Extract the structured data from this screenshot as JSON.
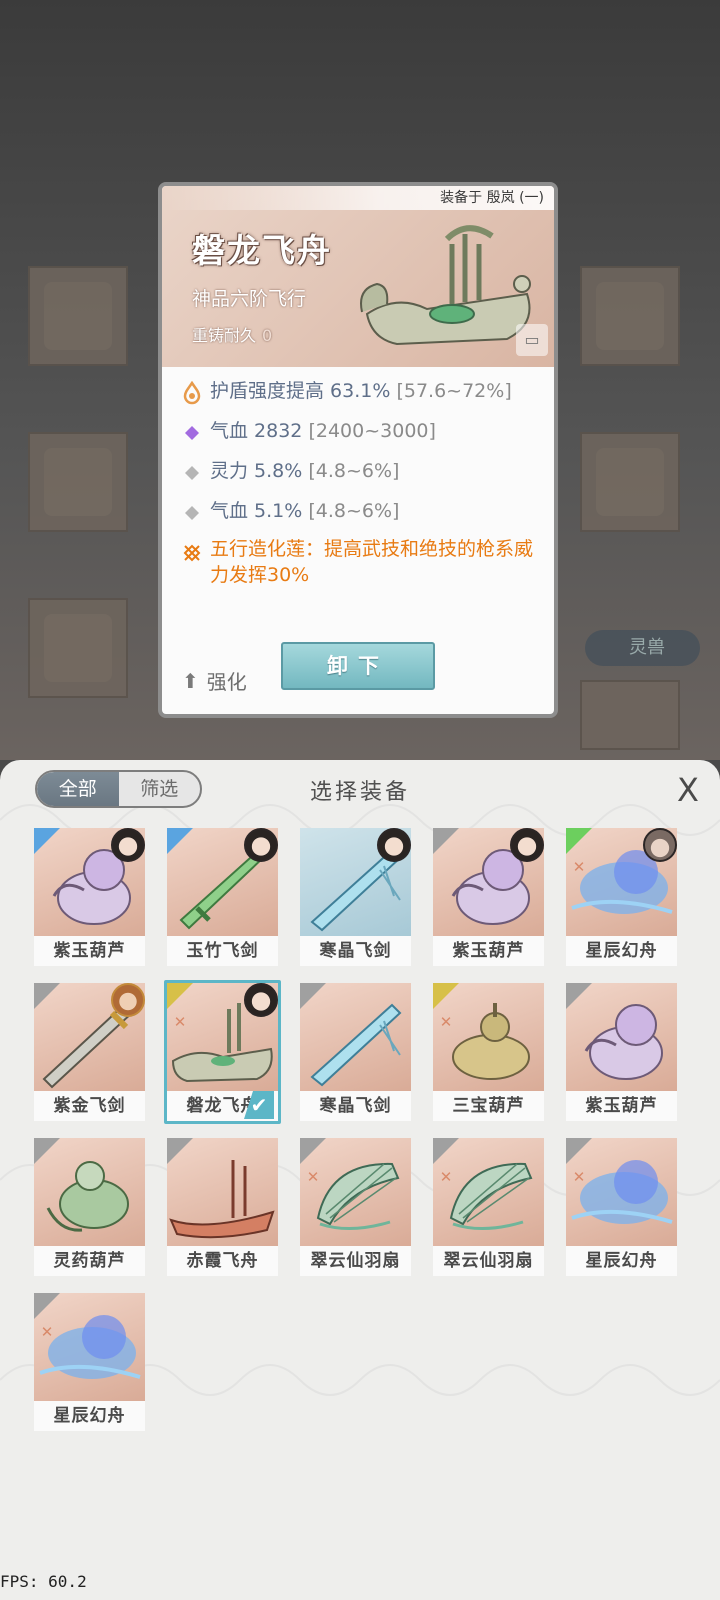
{
  "detail": {
    "equipped_by": "装备于 殷岚 (一)",
    "name": "磐龙飞舟",
    "grade": "神品六阶飞行",
    "reforge_label": "重铸耐久",
    "reforge_value": "0",
    "attributes": [
      {
        "icon": "flame-icon",
        "text": "护盾强度提高 63.1%",
        "range": "[57.6~72%]",
        "color": "#e79a4a"
      },
      {
        "icon": "purple-diamond-icon",
        "text": "气血 2832",
        "range": "[2400~3000]",
        "color": "#a26be0"
      },
      {
        "icon": "gray-diamond-icon",
        "text": "灵力 5.8%",
        "range": "[4.8~6%]",
        "color": "#b5b5b5"
      },
      {
        "icon": "gray-diamond-icon",
        "text": "气血 5.1%",
        "range": "[4.8~6%]",
        "color": "#b5b5b5"
      }
    ],
    "special": "五行造化莲：提高武技和绝技的枪系威力发挥30%",
    "strengthen_label": "强化",
    "unequip_label": "卸下"
  },
  "background": {
    "tag_label": "灵兽"
  },
  "panel": {
    "tabs": [
      "全部",
      "筛选"
    ],
    "title": "选择装备",
    "close_icon": "X"
  },
  "items": [
    {
      "name": "紫玉葫芦",
      "wing": "blue",
      "avatar": "girl",
      "bg": "peach",
      "art": "gourd-purple"
    },
    {
      "name": "玉竹飞剑",
      "wing": "blue",
      "avatar": "girl",
      "bg": "peach",
      "art": "sword-green"
    },
    {
      "name": "寒晶飞剑",
      "wing": "none",
      "avatar": "girl",
      "bg": "blue",
      "art": "sword-blue"
    },
    {
      "name": "紫玉葫芦",
      "wing": "gray",
      "avatar": "girl",
      "bg": "peach",
      "art": "gourd-purple"
    },
    {
      "name": "星辰幻舟",
      "wing": "green",
      "avatar": "cat",
      "bg": "peach",
      "art": "boat-blue",
      "rune": true
    },
    {
      "name": "紫金飞剑",
      "wing": "gray",
      "avatar": "warrior",
      "bg": "peach",
      "art": "sword-gold"
    },
    {
      "name": "磐龙飞舟",
      "wing": "gold",
      "avatar": "girl",
      "bg": "peach",
      "art": "boat-jade",
      "rune": true,
      "selected": true
    },
    {
      "name": "寒晶飞剑",
      "wing": "gray",
      "avatar": "none",
      "bg": "peach",
      "art": "sword-blue"
    },
    {
      "name": "三宝葫芦",
      "wing": "gold",
      "avatar": "none",
      "bg": "peach",
      "art": "gourd-gold",
      "rune": true
    },
    {
      "name": "紫玉葫芦",
      "wing": "gray",
      "avatar": "none",
      "bg": "peach",
      "art": "gourd-purple"
    },
    {
      "name": "灵药葫芦",
      "wing": "gray",
      "avatar": "none",
      "bg": "peach",
      "art": "gourd-green"
    },
    {
      "name": "赤霞飞舟",
      "wing": "gray",
      "avatar": "none",
      "bg": "peach",
      "art": "boat-red"
    },
    {
      "name": "翠云仙羽扇",
      "wing": "gray",
      "avatar": "none",
      "bg": "peach",
      "art": "fan-green",
      "rune": true
    },
    {
      "name": "翠云仙羽扇",
      "wing": "gray",
      "avatar": "none",
      "bg": "peach",
      "art": "fan-green",
      "rune": true
    },
    {
      "name": "星辰幻舟",
      "wing": "gray",
      "avatar": "none",
      "bg": "peach",
      "art": "boat-blue",
      "rune": true
    },
    {
      "name": "星辰幻舟",
      "wing": "gray",
      "avatar": "none",
      "bg": "peach",
      "art": "boat-blue",
      "rune": true
    }
  ],
  "fps": "FPS: 60.2"
}
